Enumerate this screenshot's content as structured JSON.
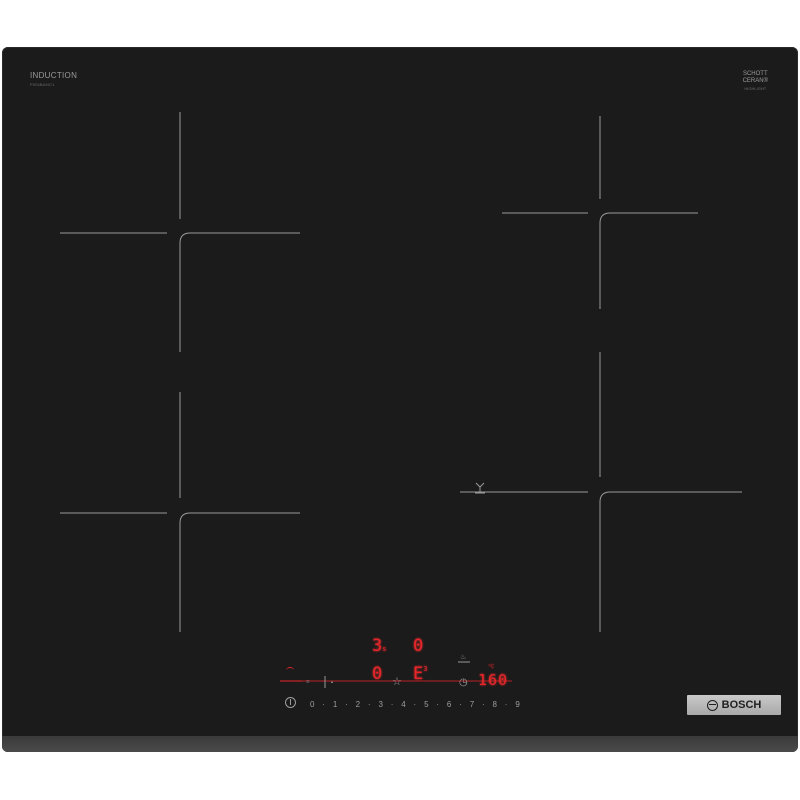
{
  "brand_top_left": {
    "title": "INDUCTION",
    "model": "PIE6BAHC1"
  },
  "brand_top_right": {
    "line1": "SCHOTT",
    "line2": "CERAN®",
    "sub": "HIGHLIGHT"
  },
  "display": {
    "left_top_digit": "3",
    "left_top_sub": "s",
    "right_top_digit": "0",
    "left_bottom_digit": "0",
    "right_bottom_digit": "E",
    "right_bottom_sub": "3",
    "timer_value": "160",
    "temp_unit": "°C"
  },
  "controls": {
    "scale": [
      "0",
      "·",
      "1",
      "·",
      "2",
      "·",
      "3",
      "·",
      "4",
      "·",
      "5",
      "·",
      "6",
      "·",
      "7",
      "·",
      "8",
      "·",
      "9"
    ],
    "power_icon": "power-icon",
    "star_icon": "☆",
    "timer_icon": "◷"
  },
  "badge": {
    "label": "BOSCH"
  },
  "colors": {
    "glass": "#1b1b1b",
    "zone_lines": "#9a9a9a",
    "display_red": "#e8262a",
    "badge": "#bcbcbc"
  }
}
